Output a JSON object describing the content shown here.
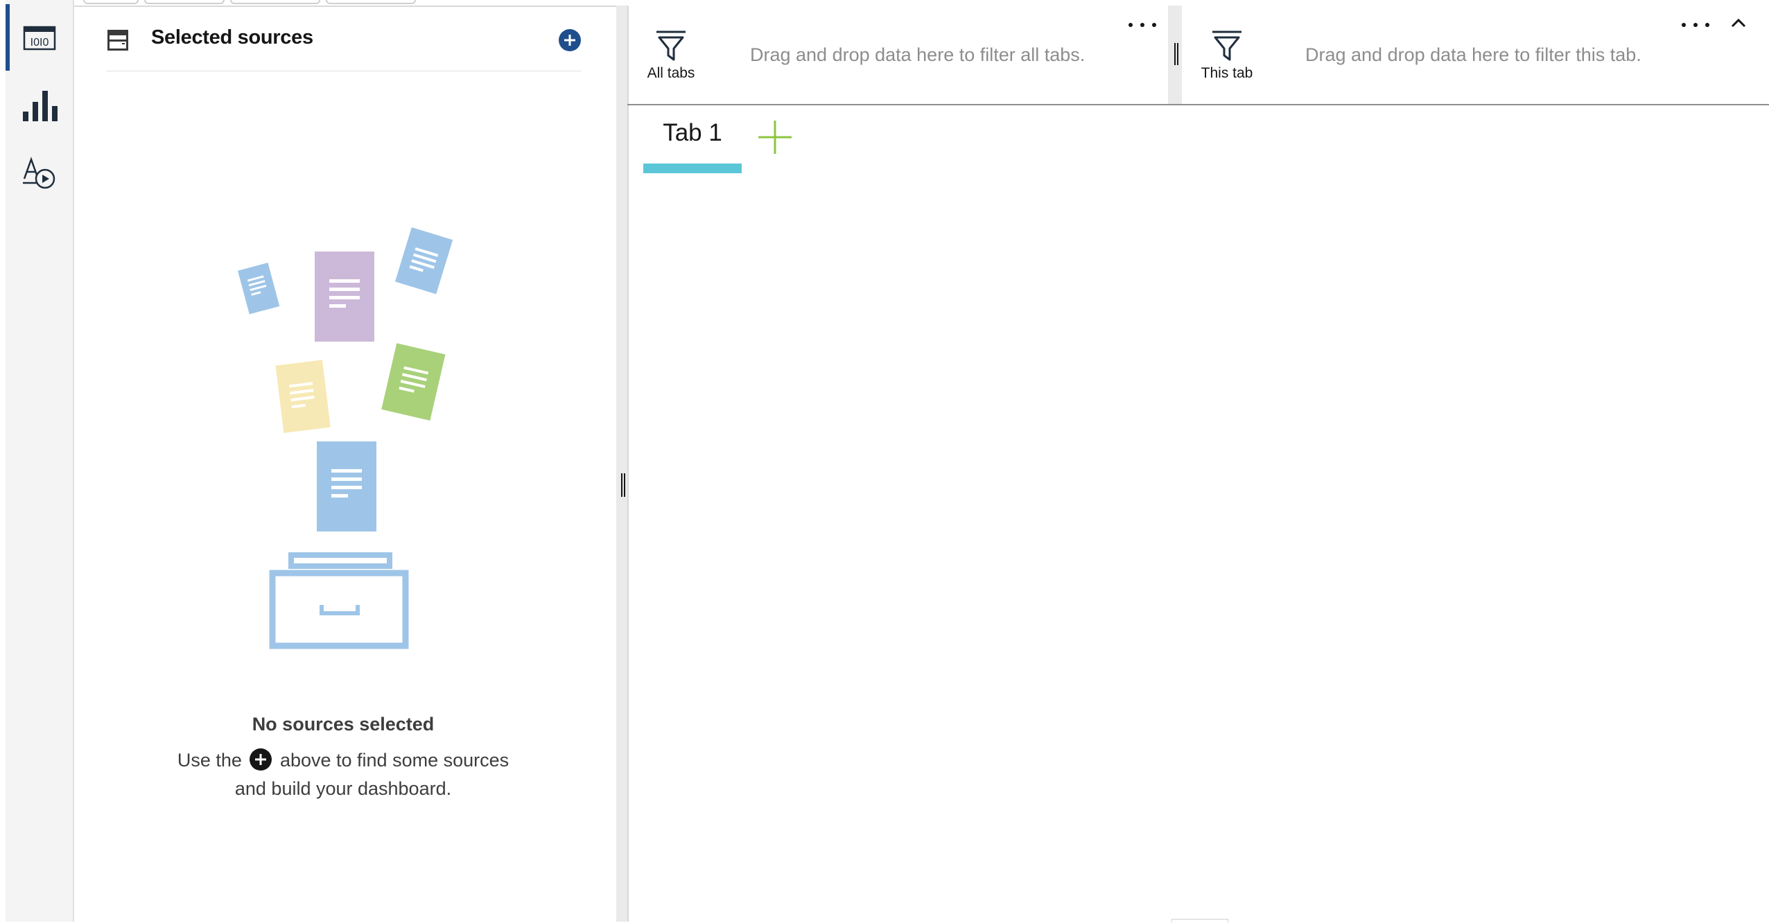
{
  "rail": {
    "items": [
      {
        "name": "data-sources-icon",
        "active": true
      },
      {
        "name": "visualizations-icon",
        "active": false
      },
      {
        "name": "assets-icon",
        "active": false
      }
    ],
    "accent": "#1f4e8c"
  },
  "sources_panel": {
    "title": "Selected sources",
    "empty_title": "No sources selected",
    "empty_line1_before": "Use the",
    "empty_line1_after": "above to find some sources",
    "empty_line2": "and build your dashboard."
  },
  "filter_bar": {
    "all_tabs": {
      "label": "All tabs",
      "hint": "Drag and drop data here to filter all tabs."
    },
    "this_tab": {
      "label": "This tab",
      "hint": "Drag and drop data here to filter this tab."
    }
  },
  "tabs": [
    {
      "label": "Tab 1",
      "active": true
    }
  ],
  "colors": {
    "accent": "#1f4e8c",
    "tab_underline": "#5bc6d8",
    "add_tab": "#8cc63f",
    "illustration_blue": "#9ec5e8",
    "illustration_purple": "#ccb8d9",
    "illustration_yellow": "#f7e9b5",
    "illustration_green": "#a8d17a"
  }
}
